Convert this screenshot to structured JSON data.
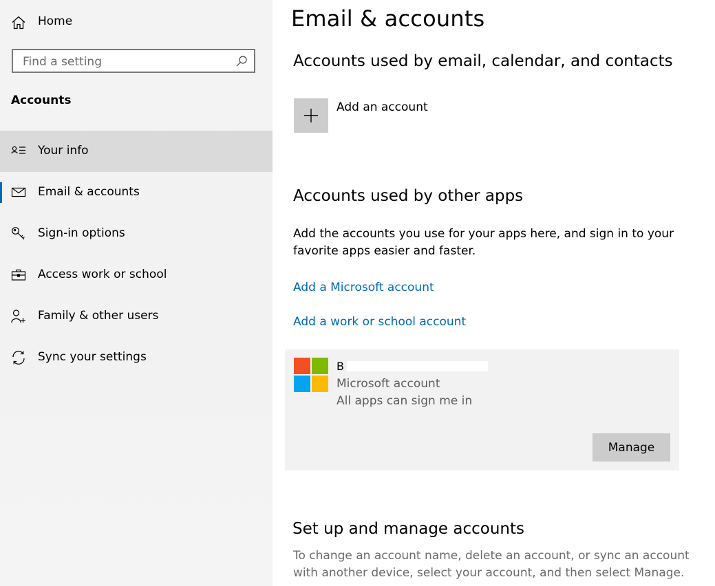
{
  "sidebar": {
    "home_label": "Home",
    "search_placeholder": "Find a setting",
    "section_title": "Accounts",
    "items": [
      {
        "label": "Your info"
      },
      {
        "label": "Email & accounts"
      },
      {
        "label": "Sign-in options"
      },
      {
        "label": "Access work or school"
      },
      {
        "label": "Family & other users"
      },
      {
        "label": "Sync your settings"
      }
    ]
  },
  "main": {
    "title": "Email & accounts",
    "section1": {
      "heading": "Accounts used by email, calendar, and contacts",
      "add_account_label": "Add an account"
    },
    "section2": {
      "heading": "Accounts used by other apps",
      "description": "Add the accounts you use for your apps here, and sign in to your favorite apps easier and faster.",
      "link_microsoft": "Add a Microsoft account",
      "link_work": "Add a work or school account",
      "account": {
        "name": "B",
        "type": "Microsoft account",
        "status": "All apps can sign me in",
        "manage_label": "Manage"
      }
    },
    "section3": {
      "heading": "Set up and manage accounts",
      "description": "To change an account name, delete an account, or sync an account with another device, select your account, and then select Manage."
    }
  },
  "colors": {
    "accent": "#0067b8",
    "ms_red": "#f25022",
    "ms_green": "#7fba00",
    "ms_blue": "#00a4ef",
    "ms_yellow": "#ffb900"
  }
}
